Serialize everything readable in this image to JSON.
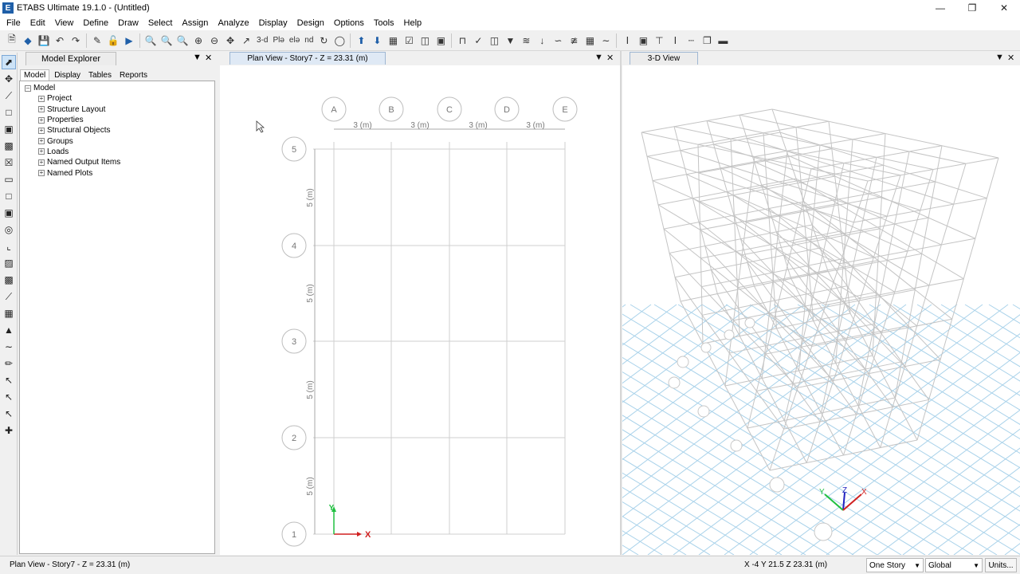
{
  "window": {
    "title": "ETABS Ultimate 19.1.0 - (Untitled)",
    "app_icon_letter": "E",
    "controls": [
      "minimize-icon",
      "restore-icon",
      "close-icon"
    ]
  },
  "menu": [
    "File",
    "Edit",
    "View",
    "Define",
    "Draw",
    "Select",
    "Assign",
    "Analyze",
    "Display",
    "Design",
    "Options",
    "Tools",
    "Help"
  ],
  "toolbar": {
    "view_3d_label": "3-d",
    "plan_label": "Plǝ",
    "elev_label": "elǝ",
    "nd_label": "nd"
  },
  "explorer": {
    "title": "Model Explorer",
    "tabs": [
      "Model",
      "Display",
      "Tables",
      "Reports"
    ],
    "active_tab": "Model",
    "root": "Model",
    "items": [
      "Project",
      "Structure Layout",
      "Properties",
      "Structural Objects",
      "Groups",
      "Loads",
      "Named Output Items",
      "Named Plots"
    ]
  },
  "plan_view": {
    "tab_title": "Plan View - Story7 - Z = 23.31 (m)",
    "grid_x_labels": [
      "A",
      "B",
      "C",
      "D",
      "E"
    ],
    "grid_y_labels": [
      "5",
      "4",
      "3",
      "2",
      "1"
    ],
    "x_spacing_label": "3 (m)",
    "y_spacing_label": "5 (m)",
    "axis_x": "X",
    "axis_y": "Y"
  },
  "view_3d": {
    "tab_title": "3-D View",
    "axis_labels": [
      "Z",
      "Y",
      "X"
    ]
  },
  "status": {
    "left_text": "Plan View - Story7 - Z = 23.31 (m)",
    "coords": "X -4  Y 21.5  Z 23.31 (m)",
    "story_option": "One Story",
    "coord_system": "Global",
    "units_button": "Units..."
  },
  "colors": {
    "accent": "#1f5fa8",
    "grid_line": "#cfcfcf",
    "ground_grid": "#a9d2ea",
    "axis_x": "#d02020",
    "axis_y": "#20c040",
    "axis_z": "#2020c0"
  }
}
